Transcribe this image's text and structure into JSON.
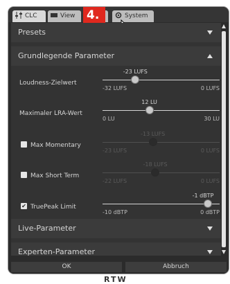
{
  "tabs": [
    {
      "label": "CLC",
      "icon": "sliders-icon",
      "active": true
    },
    {
      "label": "View",
      "icon": "monitor-icon",
      "active": false
    },
    {
      "label": "",
      "icon": "shield-icon",
      "active": false
    },
    {
      "label": "System",
      "icon": "gear-icon",
      "active": false
    }
  ],
  "step_badge": "4.",
  "sections": {
    "presets": "Presets",
    "grundlegende": "Grundlegende Parameter",
    "live": "Live-Parameter",
    "experten": "Experten-Parameter"
  },
  "params": [
    {
      "label": "Loudness-Zielwert",
      "value": "-23 LUFS",
      "min": "-32 LUFS",
      "max": "0 LUFS",
      "level": 0.28,
      "enabled": true,
      "checkbox": false
    },
    {
      "label": "Maximaler LRA-Wert",
      "value": "12 LU",
      "min": "0 LU",
      "max": "30 LU",
      "level": 0.4,
      "enabled": true,
      "checkbox": false
    },
    {
      "label": "Max Momentary",
      "value": "-13 LUFS",
      "min": "-23 LUFS",
      "max": "0 LUFS",
      "level": 0.43,
      "enabled": false,
      "checkbox": true,
      "checked": false
    },
    {
      "label": "Max Short Term",
      "value": "-18 LUFS",
      "min": "-22 LUFS",
      "max": "0 LUFS",
      "level": 0.45,
      "enabled": false,
      "checkbox": true,
      "checked": false
    },
    {
      "label": "TruePeak Limit",
      "value": "-1 dBTP",
      "min": "-10 dBTP",
      "max": "0 dBTP",
      "level": 0.9,
      "enabled": true,
      "checkbox": true,
      "checked": true
    }
  ],
  "buttons": {
    "ok": "OK",
    "cancel": "Abbruch"
  },
  "brand": "RTW",
  "colors": {
    "badge": "#e0281e",
    "panel": "#333333",
    "header": "#3b3b3b"
  }
}
